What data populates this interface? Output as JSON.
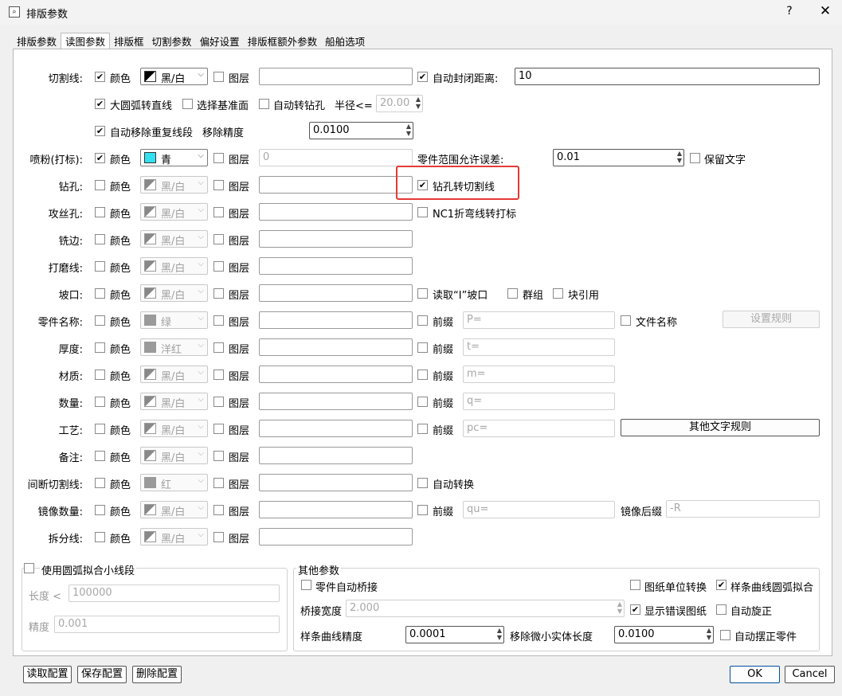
{
  "window": {
    "title": "排版参数",
    "help": "?",
    "close": "✕",
    "icon": "app-icon"
  },
  "tabs": [
    "排版参数",
    "读图参数",
    "排版框",
    "切割参数",
    "偏好设置",
    "排版框额外参数",
    "船舶选项"
  ],
  "active_tab": "读图参数",
  "common": {
    "color": "颜色",
    "layer": "图层",
    "prefix": "前缀"
  },
  "rows": [
    {
      "label": "切割线:",
      "color_checked": true,
      "combo": "黑/白",
      "combo_swatch": "black-white",
      "layer_value": ""
    },
    {
      "label": "喷粉(打标):",
      "color_checked": true,
      "combo": "青",
      "combo_swatch": "cyan",
      "layer_value": "0"
    },
    {
      "label": "钻孔:",
      "combo": "黑/白"
    },
    {
      "label": "攻丝孔:",
      "combo": "黑/白"
    },
    {
      "label": "铣边:",
      "combo": "黑/白"
    },
    {
      "label": "打磨线:",
      "combo": "黑/白"
    },
    {
      "label": "坡口:",
      "combo": "黑/白"
    },
    {
      "label": "零件名称:",
      "combo": "绿",
      "prefix_value": "P="
    },
    {
      "label": "厚度:",
      "combo": "洋红",
      "prefix_value": "t="
    },
    {
      "label": "材质:",
      "combo": "黑/白",
      "prefix_value": "m="
    },
    {
      "label": "数量:",
      "combo": "黑/白",
      "prefix_value": "q="
    },
    {
      "label": "工艺:",
      "combo": "黑/白",
      "prefix_value": "pc="
    },
    {
      "label": "备注:",
      "combo": "黑/白"
    },
    {
      "label": "间断切割线:",
      "combo": "红"
    },
    {
      "label": "镜像数量:",
      "combo": "黑/白",
      "prefix_value": "qu="
    },
    {
      "label": "拆分线:",
      "combo": "黑/白"
    }
  ],
  "cut": {
    "auto_close": "自动封闭距离:",
    "auto_close_checked": true,
    "auto_close_value": "10",
    "arc_to_line": "大圆弧转直线",
    "arc_to_line_checked": true,
    "select_base": "选择基准面",
    "auto_drill": "自动转钻孔",
    "radius": "半径<=",
    "radius_value": "20.00",
    "remove_dup": "自动移除重复线段",
    "remove_dup_checked": true,
    "remove_precision": "移除精度",
    "remove_precision_value": "0.0100"
  },
  "mark": {
    "tolerance": "零件范围允许误差:",
    "tolerance_value": "0.01",
    "keep_text": "保留文字"
  },
  "drill": {
    "to_cut": "钻孔转切割线",
    "to_cut_checked": true
  },
  "tap": {
    "nc1": "NC1折弯线转打标"
  },
  "bevel": {
    "read": "读取“I”坡口",
    "group": "群组",
    "block": "块引用"
  },
  "partname": {
    "file_name": "文件名称",
    "set_rule": "设置规则"
  },
  "process": {
    "other_rules": "其他文字规则"
  },
  "dashed": {
    "auto_convert": "自动转换"
  },
  "mirror": {
    "suffix": "镜像后缀",
    "suffix_value": "-R"
  },
  "arcfit": {
    "title": "使用圆弧拟合小线段",
    "length": "长度 <",
    "length_value": "100000",
    "precision": "精度",
    "precision_value": "0.001"
  },
  "other": {
    "title": "其他参数",
    "auto_bridge": "零件自动桥接",
    "unit_convert": "图纸单位转换",
    "spline_fit": "样条曲线圆弧拟合",
    "spline_fit_checked": true,
    "bridge_width": "桥接宽度",
    "bridge_width_value": "2.000",
    "show_error": "显示错误图纸",
    "show_error_checked": true,
    "auto_rotate": "自动旋正",
    "spline_precision": "样条曲线精度",
    "spline_precision_value": "0.0001",
    "remove_small": "移除微小实体长度",
    "remove_small_value": "0.0100",
    "auto_place": "自动摆正零件"
  },
  "footer": {
    "read_config": "读取配置",
    "save_config": "保存配置",
    "delete_config": "删除配置",
    "ok": "OK",
    "cancel": "Cancel"
  }
}
